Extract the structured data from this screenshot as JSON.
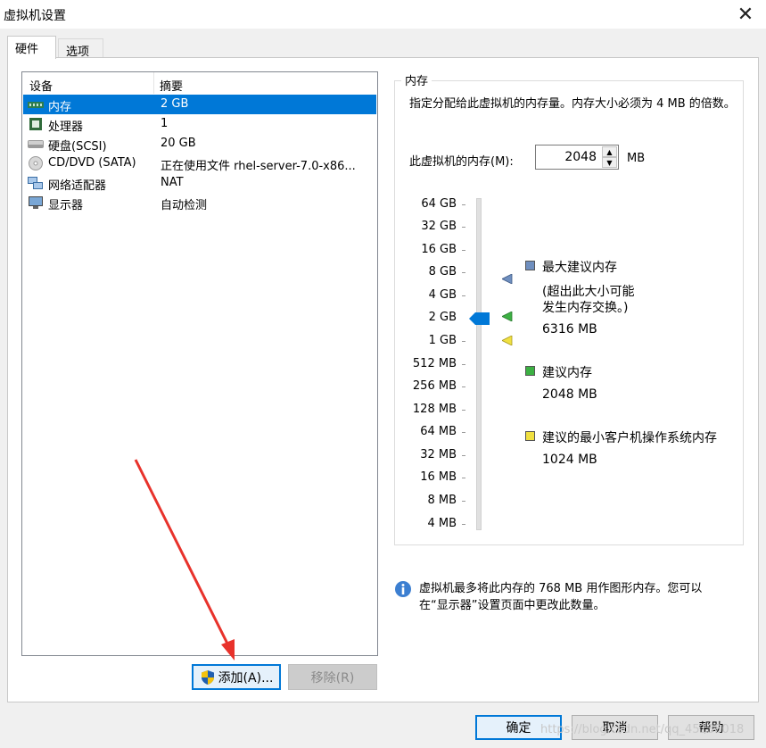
{
  "window": {
    "title": "虚拟机设置"
  },
  "tabs": [
    {
      "label": "硬件"
    },
    {
      "label": "选项"
    }
  ],
  "device_list": {
    "columns": [
      "设备",
      "摘要"
    ],
    "rows": [
      {
        "name": "内存",
        "summary": "2 GB",
        "icon": "memory-icon"
      },
      {
        "name": "处理器",
        "summary": "1",
        "icon": "processor-icon"
      },
      {
        "name": "硬盘(SCSI)",
        "summary": "20 GB",
        "icon": "harddisk-icon"
      },
      {
        "name": "CD/DVD (SATA)",
        "summary": "正在使用文件 rhel-server-7.0-x86...",
        "icon": "cd-dvd-icon"
      },
      {
        "name": "网络适配器",
        "summary": "NAT",
        "icon": "network-adapter-icon"
      },
      {
        "name": "显示器",
        "summary": "自动检测",
        "icon": "display-icon"
      }
    ],
    "selected_index": 0
  },
  "list_buttons": {
    "add": "添加(A)...",
    "remove": "移除(R)"
  },
  "memory": {
    "group_label": "内存",
    "description": "指定分配给此虚拟机的内存量。内存大小必须为 4 MB 的倍数。",
    "vm_memory_label": "此虚拟机的内存(M):",
    "vm_memory_value": "2048",
    "unit": "MB",
    "scale_ticks": [
      "64 GB",
      "32 GB",
      "16 GB",
      "8 GB",
      "4 GB",
      "2 GB",
      "1 GB",
      "512 MB",
      "256 MB",
      "128 MB",
      "64 MB",
      "32 MB",
      "16 MB",
      "8 MB",
      "4 MB"
    ],
    "legend": {
      "max": {
        "label": "最大建议内存",
        "note1": "(超出此大小可能",
        "note2": "发生内存交换。)",
        "value": "6316 MB",
        "color": "#6f8fbf"
      },
      "recommended": {
        "label": "建议内存",
        "value": "2048 MB",
        "color": "#3cb043"
      },
      "min_guest": {
        "label": "建议的最小客户机操作系统内存",
        "value": "1024 MB",
        "color": "#f0e040"
      }
    }
  },
  "info": {
    "line1": "虚拟机最多将此内存的 768 MB 用作图形内存。您可以",
    "line2": "在“显示器”设置页面中更改此数量。"
  },
  "dialog_buttons": {
    "ok": "确定",
    "cancel": "取消",
    "help": "帮助"
  },
  "watermark": "https://blog.csdn.net/qq_45138018"
}
